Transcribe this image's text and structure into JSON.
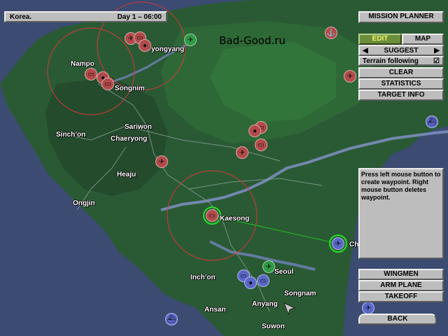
{
  "status": {
    "location": "Korea.",
    "day_time": "Day 1 – 06:00"
  },
  "watermark": "Bad-Good.ru",
  "panel": {
    "title": "MISSION PLANNER",
    "tabs": [
      "EDIT",
      "MAP"
    ],
    "suggest": "SUGGEST",
    "terrain_following": "Terrain following",
    "terrain_following_checkbox": "☑",
    "buttons": [
      "CLEAR",
      "STATISTICS",
      "TARGET INFO"
    ],
    "help_text": "Press left mouse button to create waypoint. Right mouse button deletes waypoint.",
    "lower_buttons": [
      "WINGMEN",
      "ARM PLANE",
      "TAKEOFF"
    ],
    "back": "BACK"
  },
  "places": [
    "Nampo",
    "yongyang",
    "Songnim",
    "Sariwon",
    "Sinch’on",
    "Chaeryong",
    "Heaju",
    "Ongjin",
    "Kaesong",
    "Inch’on",
    "Seoul",
    "Songnam",
    "Ansan",
    "Anyang",
    "Suwon",
    "Ch"
  ],
  "colors": {
    "enemy": "#b24a4a",
    "friendly": "#5a67c9",
    "waypoint": "#20c020",
    "range": "#d23a3a",
    "land": "#2a5a34",
    "sea": "#3b4b72"
  }
}
